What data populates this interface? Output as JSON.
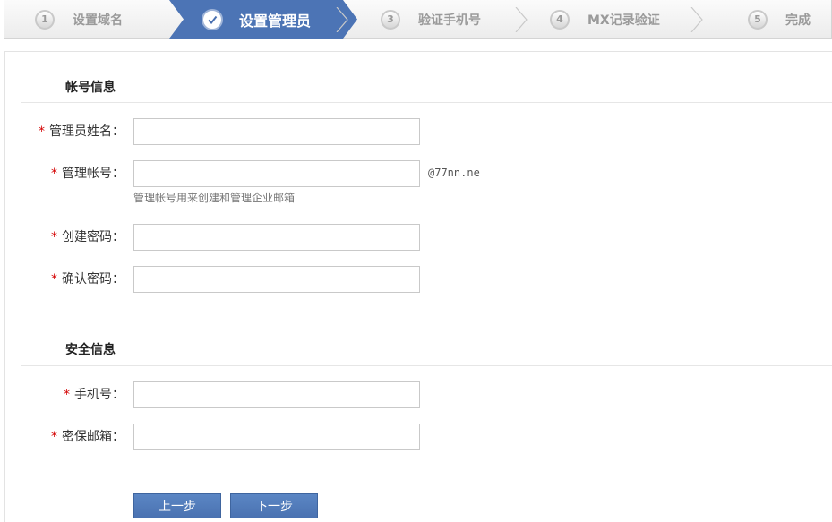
{
  "steps": [
    {
      "num": "1",
      "label": "设置域名",
      "state": "done"
    },
    {
      "num": "✓",
      "label": "设置管理员",
      "state": "active"
    },
    {
      "num": "3",
      "label": "验证手机号",
      "state": "todo"
    },
    {
      "num": "4",
      "label": "MX记录验证",
      "state": "todo"
    },
    {
      "num": "5",
      "label": "完成",
      "state": "todo"
    }
  ],
  "account_section": {
    "title": "帐号信息",
    "required_mark": "*",
    "admin_name": {
      "label": "管理员姓名：",
      "value": ""
    },
    "admin_account": {
      "label": "管理帐号：",
      "value": "",
      "suffix": "@77nn.ne",
      "hint": "管理帐号用来创建和管理企业邮箱"
    },
    "create_password": {
      "label": "创建密码：",
      "value": ""
    },
    "confirm_password": {
      "label": "确认密码：",
      "value": ""
    }
  },
  "security_section": {
    "title": "安全信息",
    "phone": {
      "label": "手机号：",
      "value": ""
    },
    "backup_email": {
      "label": "密保邮箱：",
      "value": ""
    }
  },
  "buttons": {
    "prev": "上一步",
    "next": "下一步"
  },
  "colors": {
    "accent": "#4a72b1",
    "required": "#d40000"
  }
}
